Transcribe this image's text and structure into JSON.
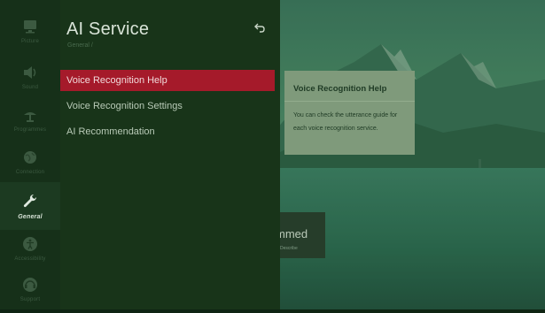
{
  "sidebar": {
    "items": [
      {
        "label": "Picture",
        "icon": "picture-icon",
        "active": false
      },
      {
        "label": "Sound",
        "icon": "sound-icon",
        "active": false
      },
      {
        "label": "Programmes",
        "icon": "antenna-icon",
        "active": false
      },
      {
        "label": "Connection",
        "icon": "globe-icon",
        "active": false
      },
      {
        "label": "General",
        "icon": "wrench-icon",
        "active": true
      },
      {
        "label": "Accessibility",
        "icon": "accessibility-icon",
        "active": false
      },
      {
        "label": "Support",
        "icon": "support-icon",
        "active": false
      }
    ]
  },
  "panel": {
    "title": "AI Service",
    "breadcrumb": "General /",
    "back_icon": "back-arrow-icon",
    "items": [
      {
        "label": "Voice Recognition Help",
        "selected": true
      },
      {
        "label": "Voice Recognition Settings",
        "selected": false
      },
      {
        "label": "AI Recommendation",
        "selected": false
      }
    ]
  },
  "help_card": {
    "title": "Voice Recognition Help",
    "body": "You can check the utterance guide for each voice recognition service."
  },
  "background_banner": {
    "title_fragment": "mmed",
    "subtitle_fragment": "Describe"
  },
  "colors": {
    "selection": "#a51a2a",
    "panel": "#183419",
    "rail": "#163019",
    "help_card": "#7f9a7b"
  }
}
